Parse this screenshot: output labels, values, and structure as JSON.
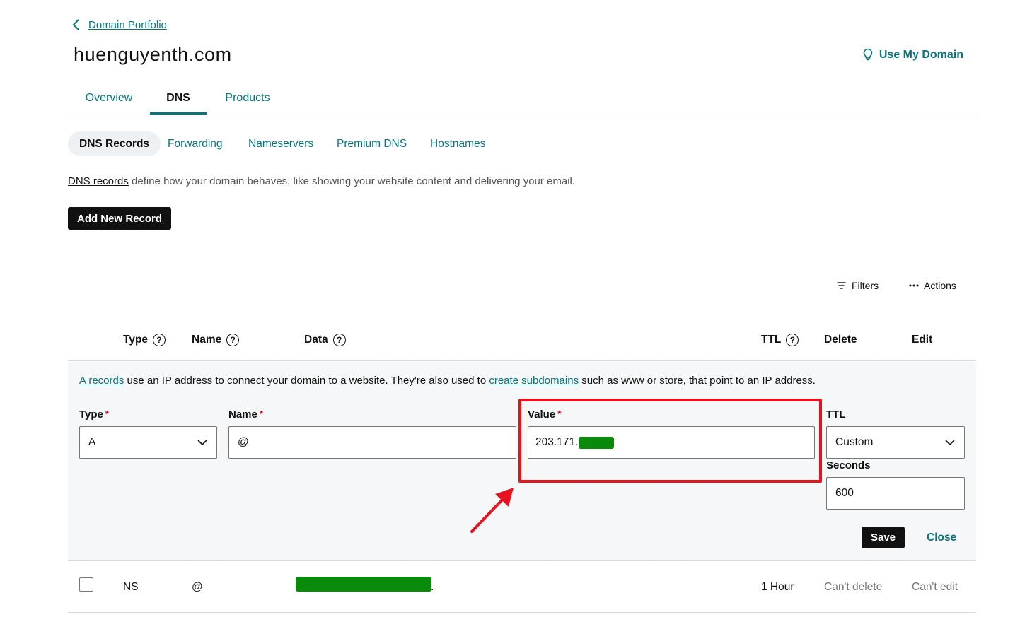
{
  "breadcrumb": {
    "label": "Domain Portfolio"
  },
  "page": {
    "title": "huenguyenth.com"
  },
  "header": {
    "use_domain_label": "Use My Domain"
  },
  "main_tabs": [
    {
      "label": "Overview",
      "active": false
    },
    {
      "label": "DNS",
      "active": true
    },
    {
      "label": "Products",
      "active": false
    }
  ],
  "sub_tabs": [
    {
      "label": "DNS Records",
      "active": true
    },
    {
      "label": "Forwarding",
      "active": false
    },
    {
      "label": "Nameservers",
      "active": false
    },
    {
      "label": "Premium DNS",
      "active": false
    },
    {
      "label": "Hostnames",
      "active": false
    }
  ],
  "intro": {
    "link_text": "DNS records",
    "text": " define how your domain behaves, like showing your website content and delivering your email."
  },
  "add_record_label": "Add New Record",
  "toolbar": {
    "filters_label": "Filters",
    "actions_label": "Actions"
  },
  "table": {
    "headers": {
      "type": "Type",
      "name": "Name",
      "data": "Data",
      "ttl": "TTL",
      "delete": "Delete",
      "edit": "Edit"
    },
    "help_glyph": "?"
  },
  "edit_form": {
    "description": {
      "link1": "A records",
      "text1": " use an IP address to connect your domain to a website. They're also used to ",
      "link2": "create subdomains",
      "text2": " such as www or store, that point to an IP address."
    },
    "required_mark": "*",
    "type": {
      "label": "Type",
      "value": "A"
    },
    "name": {
      "label": "Name",
      "value": "@"
    },
    "value": {
      "label": "Value",
      "value_visible": "203.171."
    },
    "ttl": {
      "label": "TTL",
      "value": "Custom"
    },
    "seconds": {
      "label": "Seconds",
      "value": "600"
    },
    "save_label": "Save",
    "close_label": "Close"
  },
  "records": [
    {
      "type": "NS",
      "name": "@",
      "data_suffix": ".",
      "ttl": "1 Hour",
      "delete": "Can't delete",
      "edit": "Can't edit"
    }
  ],
  "colors": {
    "accent": "#09757a",
    "highlight": "#e5141f",
    "mask": "#0a8a0a"
  }
}
